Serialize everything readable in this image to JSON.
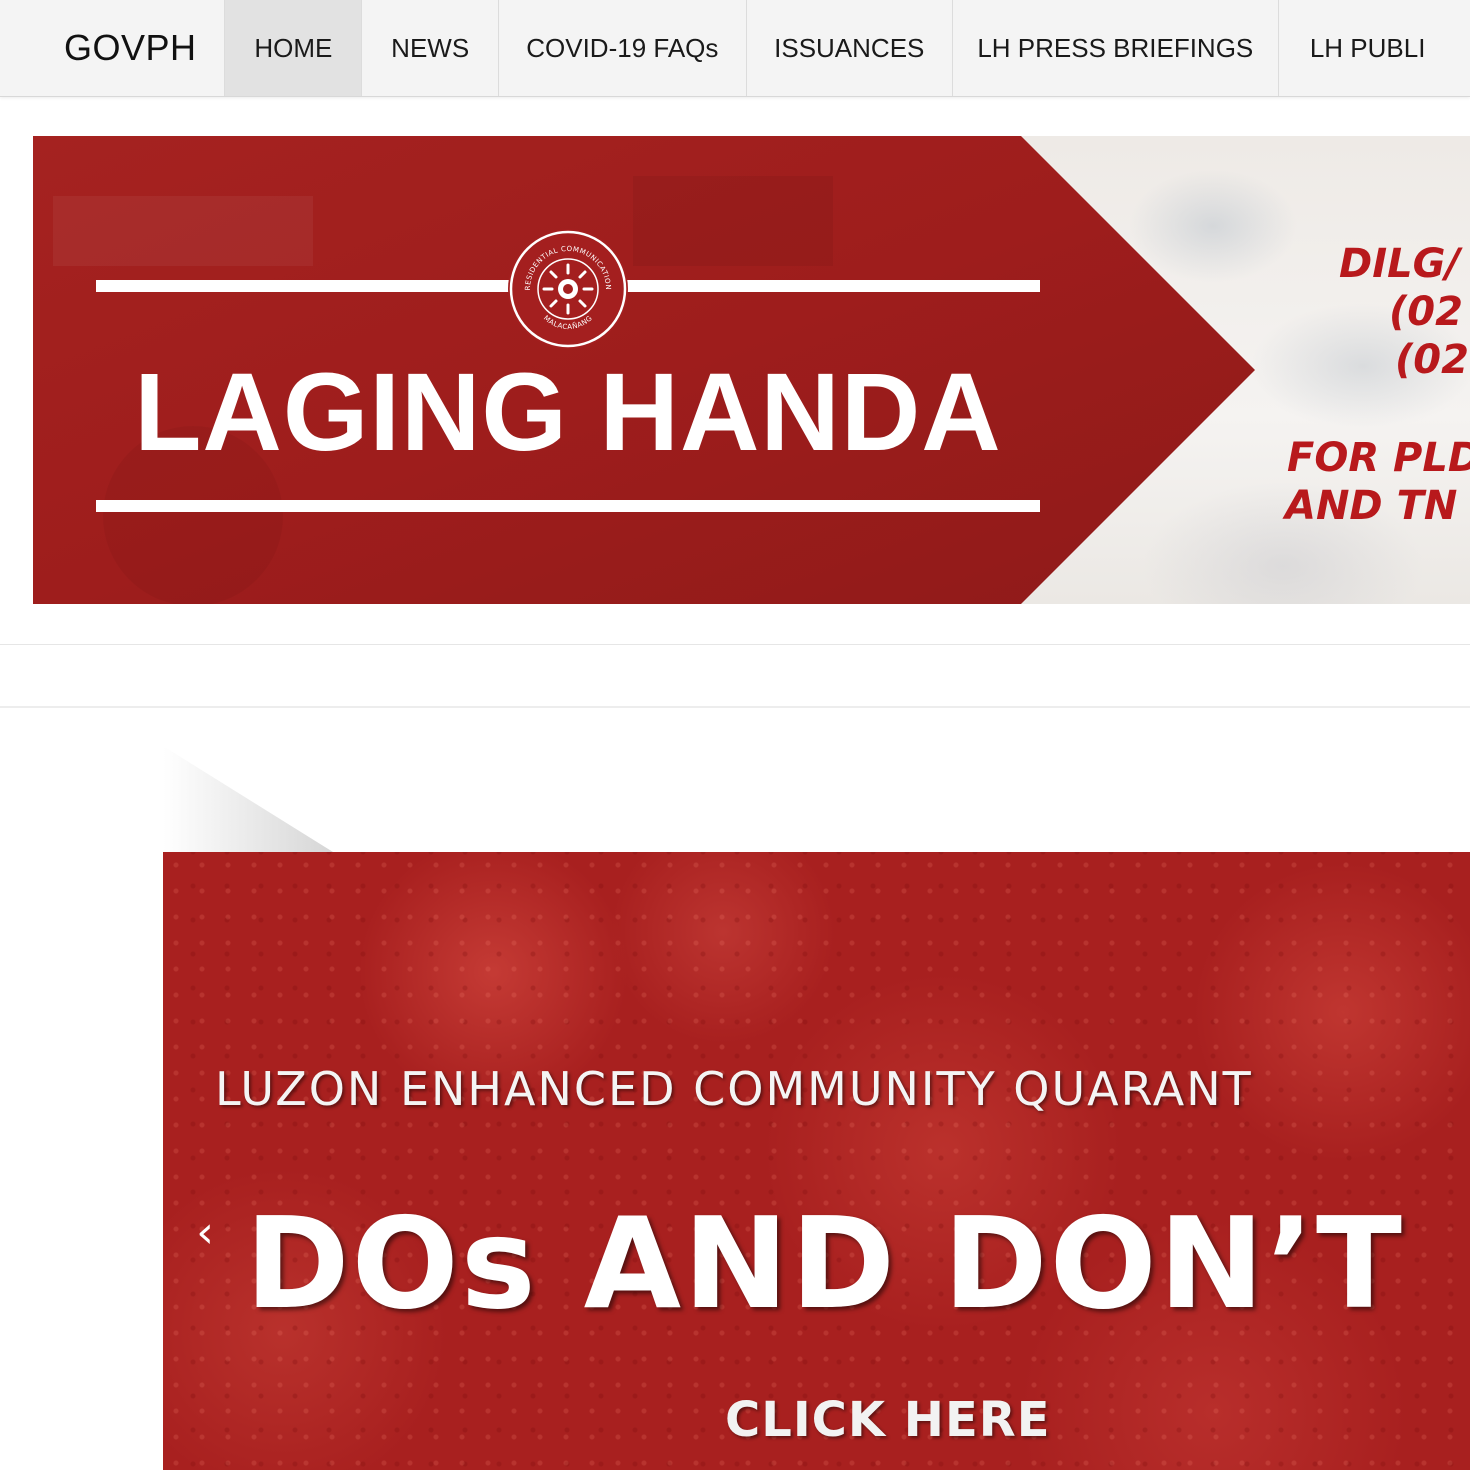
{
  "nav": {
    "brand": "GOVPH",
    "items": [
      {
        "label": "HOME",
        "active": true
      },
      {
        "label": "NEWS",
        "active": false
      },
      {
        "label": "COVID-19 FAQs",
        "active": false
      },
      {
        "label": "ISSUANCES",
        "active": false
      },
      {
        "label": "LH PRESS BRIEFINGS",
        "active": false
      },
      {
        "label": "LH PUBLI",
        "active": false
      }
    ]
  },
  "banner": {
    "title": "LAGING HANDA",
    "seal_icon": "presidential-communications-seal",
    "seal_text": [
      "PRESIDENTIAL COMMUNICATIONS",
      "MALACAÑANG"
    ],
    "side_lines": [
      "DILG/",
      "(02",
      "(02",
      "FOR PLD",
      "AND TN"
    ],
    "colors": {
      "red": "#a41f1f",
      "accent_text": "#b8191c"
    }
  },
  "slider": {
    "subtitle": "LUZON ENHANCED COMMUNITY QUARANT",
    "title": "DOs AND DON’T",
    "cta": "CLICK HERE",
    "prev_icon": "chevron-left-icon",
    "prev_glyph": "‹",
    "background_color": "#a8201f"
  }
}
